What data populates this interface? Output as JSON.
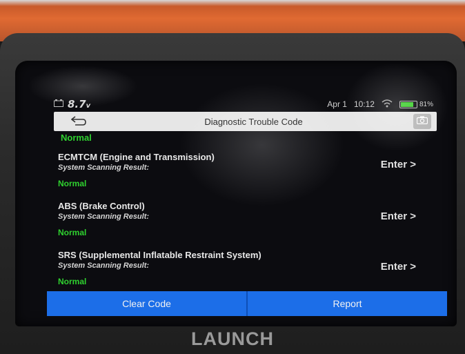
{
  "status_bar": {
    "voltage": "8.7",
    "voltage_unit": "v",
    "date": "Apr 1",
    "time": "10:12",
    "battery_percent": "81%"
  },
  "header": {
    "title": "Diagnostic Trouble Code"
  },
  "list": {
    "partial_top_status": "Normal",
    "systems": [
      {
        "name": "ECMTCM (Engine and Transmission)",
        "scan_label": "System Scanning Result:",
        "status": "Normal",
        "action": "Enter >"
      },
      {
        "name": "ABS (Brake Control)",
        "scan_label": "System Scanning Result:",
        "status": "Normal",
        "action": "Enter >"
      },
      {
        "name": "SRS (Supplemental Inflatable Restraint System)",
        "scan_label": "System Scanning Result:",
        "status": "Normal",
        "action": "Enter >"
      }
    ]
  },
  "footer": {
    "clear_code_label": "Clear Code",
    "report_label": "Report"
  },
  "brand": "LAUNCH",
  "colors": {
    "accent_blue": "#1c6ee8",
    "status_green": "#2fd12f",
    "bezel_orange": "#e06a32"
  },
  "icons": [
    "car-battery-icon",
    "wifi-icon",
    "battery-icon",
    "back-arrow-icon",
    "camera-icon"
  ]
}
